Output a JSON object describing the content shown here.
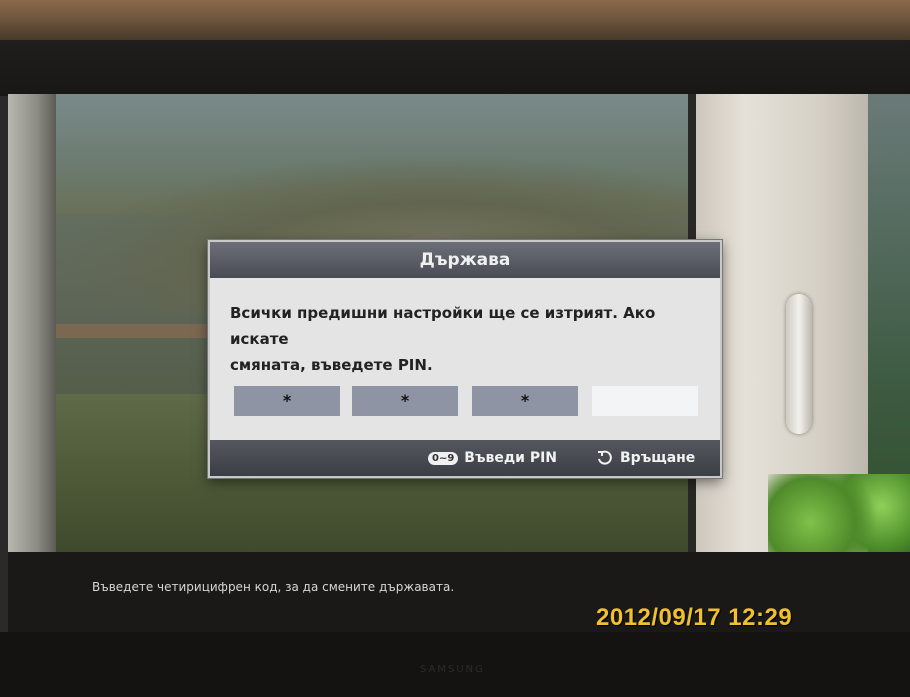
{
  "dialog": {
    "title": "Държава",
    "message_line1": "Всички предишни настройки ще се изтрият. Ако искате",
    "message_line2": "смяната, въведете PIN.",
    "pin_slots": [
      "*",
      "*",
      "*",
      ""
    ],
    "footer": {
      "enter_pin_key": "0~9",
      "enter_pin_label": "Въведи PIN",
      "return_label": "Връщане"
    }
  },
  "hint": "Въведете четирицифрен код, за да смените държавата.",
  "camera_timestamp": "2012/09/17 12:29",
  "brand": "SAMSUNG",
  "icons": [
    "return-icon"
  ],
  "colors": {
    "dialog_header": "#55575f",
    "pin_filled": "#8e94a3",
    "pin_empty": "#f3f4f6",
    "timestamp": "#f0c030"
  }
}
